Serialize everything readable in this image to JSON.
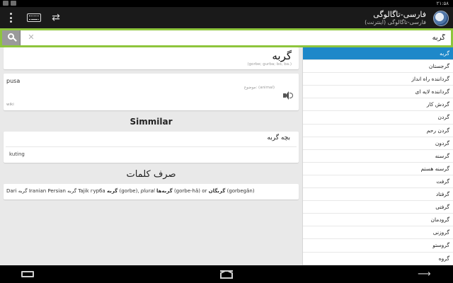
{
  "status_bar": {
    "time": "۲۱:۵۸"
  },
  "action_bar": {
    "title": "فارسی-تاگالوگی",
    "subtitle": "فارسی-تاگالوگی (اینترنت)",
    "menu_icon": "overflow-menu-icon",
    "keyboard_icon": "keyboard-icon",
    "swap_icon": "swap-icon",
    "swap_glyph": "⇄"
  },
  "search": {
    "value": "گربه",
    "clear_glyph": "✕"
  },
  "entry": {
    "word": "گربه",
    "transliteration": "(gorbe; gurba; bo, ba.)",
    "translation": "pusa",
    "subject": "موضوع: (animal)",
    "source": "wiki"
  },
  "similar": {
    "heading": "Simmilar",
    "word": "بچه گربه",
    "translation": "kuting"
  },
  "inflection": {
    "heading": "صرف کلمات",
    "text_1": "Dari گربه Iranian Persian گربه Tajik гурба ",
    "bold_1": "گربه",
    "text_2": " (gorbe), ",
    "italic": "plural",
    "text_3": " ",
    "bold_2": "گربه‌ها",
    "text_4": " (gorbe-hâ) or ",
    "bold_3": "گربگان",
    "text_5": " (gorbegân)"
  },
  "word_list": [
    "گربه",
    "گرجستان",
    "گرداننده راه انداز",
    "گرداننده لایه ای",
    "گردش کار",
    "گردن",
    "گردن رحم",
    "گردون",
    "گرسنه",
    "گرسنه هستم",
    "گرفت",
    "گرفتاد",
    "گرفتی",
    "گرودمان",
    "گروزنی",
    "گروستو",
    "گروه"
  ],
  "nav": {
    "recent_glyph": "⟶"
  }
}
